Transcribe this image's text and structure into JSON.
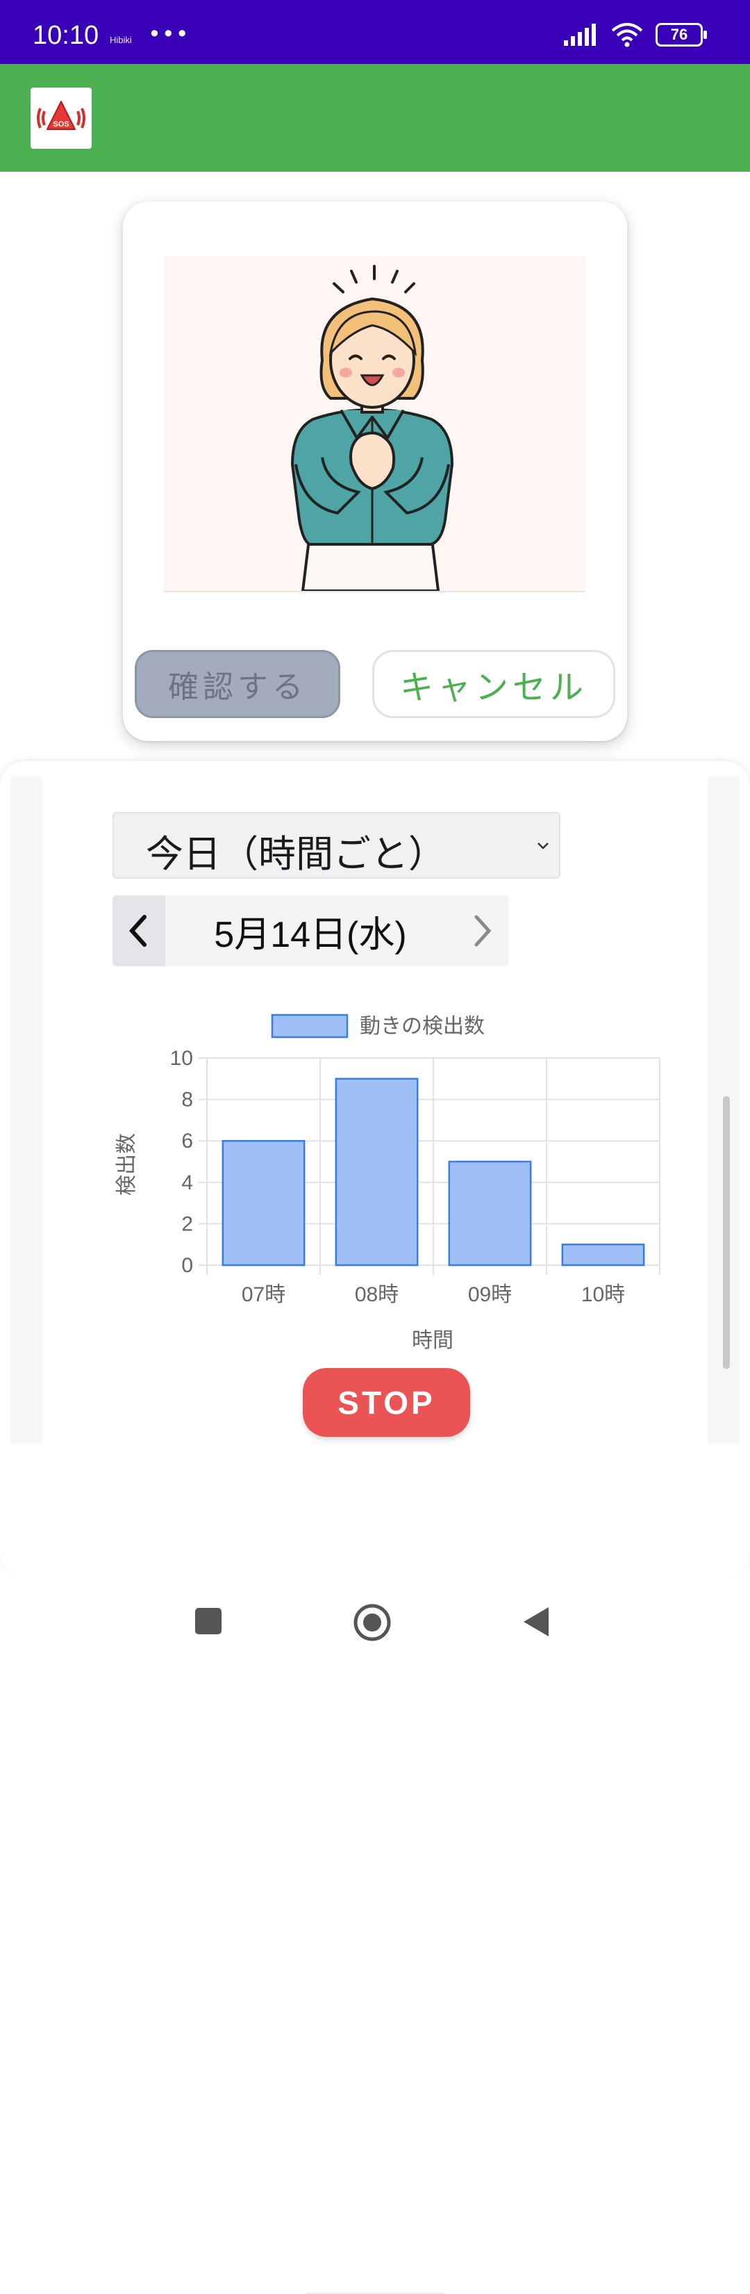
{
  "status_bar": {
    "time": "10:10",
    "carrier": "Hibiki",
    "dots": "•••",
    "battery": "76"
  },
  "dialog": {
    "confirm_label": "確認する",
    "cancel_label": "キャンセル"
  },
  "filter": {
    "range_selected": "今日（時間ごと）"
  },
  "date_nav": {
    "date": "5月14日(水)"
  },
  "chart_data": {
    "type": "bar",
    "categories": [
      "07時",
      "08時",
      "09時",
      "10時"
    ],
    "series": [
      {
        "name": "動きの検出数",
        "values": [
          6,
          9,
          5,
          1
        ]
      }
    ],
    "xlabel": "時間",
    "ylabel": "検出数",
    "ylim": [
      0,
      10
    ],
    "yticks": [
      0,
      2,
      4,
      6,
      8,
      10
    ],
    "legend": "top",
    "grid": true,
    "colors": {
      "fill": "#9fc0f7",
      "stroke": "#3b7be8"
    }
  },
  "actions": {
    "stop_label": "STOP"
  },
  "colors": {
    "status_bar": "#3a00b7",
    "app_bar": "#4caf50",
    "stop": "#ea5455"
  }
}
